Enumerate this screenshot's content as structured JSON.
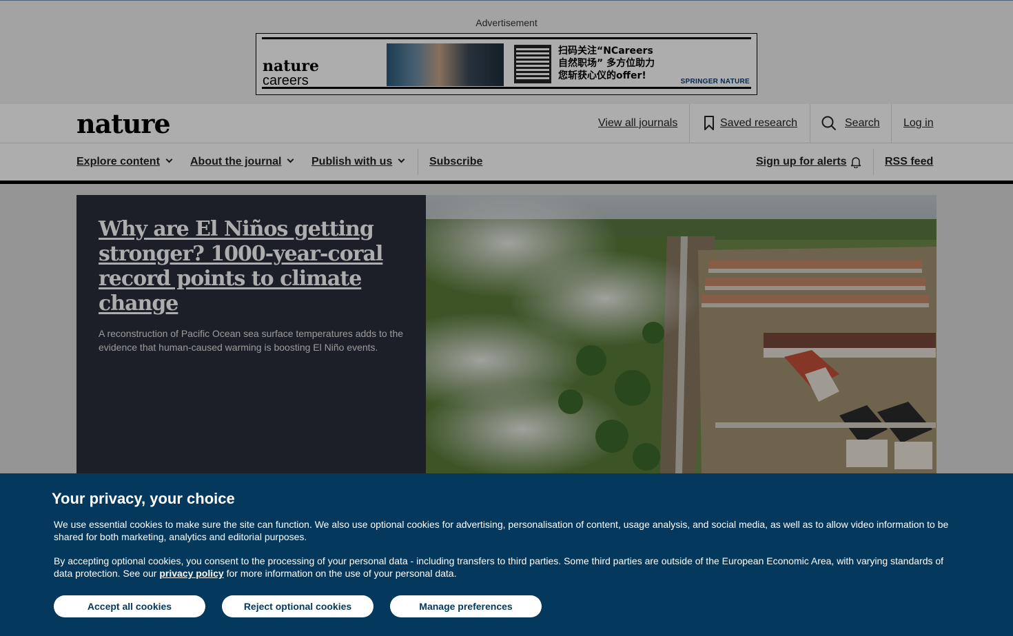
{
  "ad": {
    "label": "Advertisement",
    "logo_line1": "nature",
    "logo_line2": "careers",
    "cn_line1": "扫码关注“NCareers",
    "cn_line2": "自然职场” 多方位助力",
    "cn_line3": "您斩获心仪的offer!",
    "publisher": "SPRINGER NATURE"
  },
  "header": {
    "logo": "nature",
    "view_all_journals": "View all journals",
    "saved_research": "Saved research",
    "search": "Search",
    "login": "Log in"
  },
  "nav": {
    "explore": "Explore content",
    "about": "About the journal",
    "publish": "Publish with us",
    "subscribe": "Subscribe",
    "alerts": "Sign up for alerts",
    "rss": "RSS feed"
  },
  "hero": {
    "title": "Why are El Niños getting stronger? 1000-year-coral record points to climate change",
    "summary": "A reconstruction of Pacific Ocean sea surface temperatures adds to the evidence that human-caused warming is boosting El Niño events."
  },
  "cookie": {
    "title": "Your privacy, your choice",
    "p1": "We use essential cookies to make sure the site can function. We also use optional cookies for advertising, personalisation of content, usage analysis, and social media, as well as to allow video information to be shared for both marketing, analytics and editorial purposes.",
    "p2_before": "By accepting optional cookies, you consent to the processing of your personal data - including transfers to third parties. Some third parties are outside of the European Economic Area, with varying standards of data protection. See our ",
    "p2_link": "privacy policy",
    "p2_after": " for more information on the use of your personal data.",
    "accept": "Accept all cookies",
    "reject": "Reject optional cookies",
    "manage": "Manage preferences"
  },
  "colors": {
    "cookie_bg": "#04385c",
    "hero_panel": "#2a2e3a"
  }
}
